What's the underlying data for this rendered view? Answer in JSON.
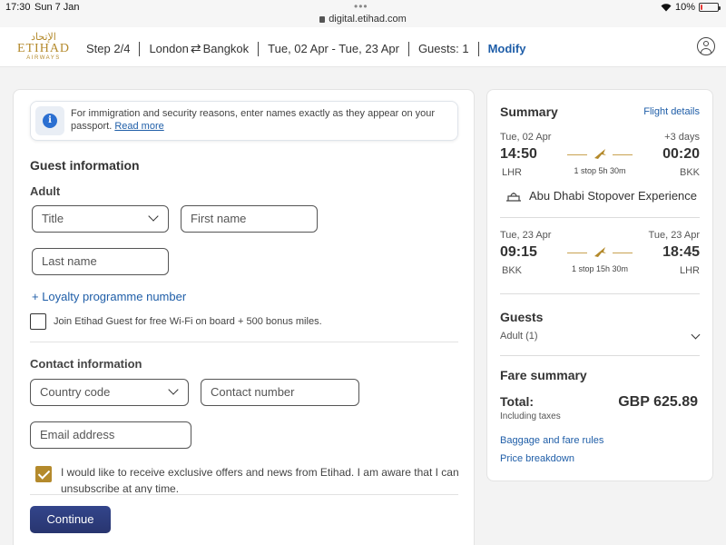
{
  "status_bar": {
    "time": "17:30",
    "date": "Sun 7 Jan",
    "url": "digital.etihad.com",
    "battery": "10%"
  },
  "header": {
    "logo_arabic": "الإتحاد",
    "logo_brand": "ETIHAD",
    "logo_sub": "AIRWAYS",
    "step": "Step 2/4",
    "origin": "London",
    "destination": "Bangkok",
    "dates": "Tue, 02 Apr - Tue, 23 Apr",
    "guests": "Guests: 1",
    "modify": "Modify"
  },
  "notice": {
    "text": "For immigration and security reasons, enter names exactly as they appear on your passport.",
    "link": "Read more"
  },
  "guest_info": {
    "heading": "Guest information",
    "subheading": "Adult",
    "title_placeholder": "Title",
    "first_name_placeholder": "First name",
    "last_name_placeholder": "Last name",
    "loyalty_link": "+ Loyalty programme number",
    "join_label": "Join Etihad Guest for free Wi-Fi on board + 500 bonus miles."
  },
  "contact_info": {
    "heading": "Contact information",
    "country_code_placeholder": "Country code",
    "contact_number_placeholder": "Contact number",
    "email_placeholder": "Email address",
    "offers_label": "I would like to receive exclusive offers and news from Etihad. I am aware that I can unsubscribe at any time."
  },
  "continue_button": "Continue",
  "summary": {
    "title": "Summary",
    "flight_details_link": "Flight details",
    "outbound": {
      "date": "Tue, 02 Apr",
      "days_offset": "+3 days",
      "depart_time": "14:50",
      "arrive_time": "00:20",
      "stops": "1 stop 5h 30m",
      "from": "LHR",
      "to": "BKK"
    },
    "stopover_label": "Abu Dhabi Stopover Experience",
    "inbound": {
      "date_depart": "Tue, 23 Apr",
      "date_arrive": "Tue, 23 Apr",
      "depart_time": "09:15",
      "arrive_time": "18:45",
      "stops": "1 stop 15h 30m",
      "from": "BKK",
      "to": "LHR"
    },
    "guests_title": "Guests",
    "guests_value": "Adult (1)",
    "fare_title": "Fare summary",
    "total_label": "Total:",
    "taxes_note": "Including taxes",
    "total_amount": "GBP 625.89",
    "baggage_link": "Baggage and fare rules",
    "price_link": "Price breakdown"
  },
  "colors": {
    "brand_gold": "#b48a2c",
    "link_blue": "#1f5ea8",
    "button_navy": "#2b3a7a"
  }
}
